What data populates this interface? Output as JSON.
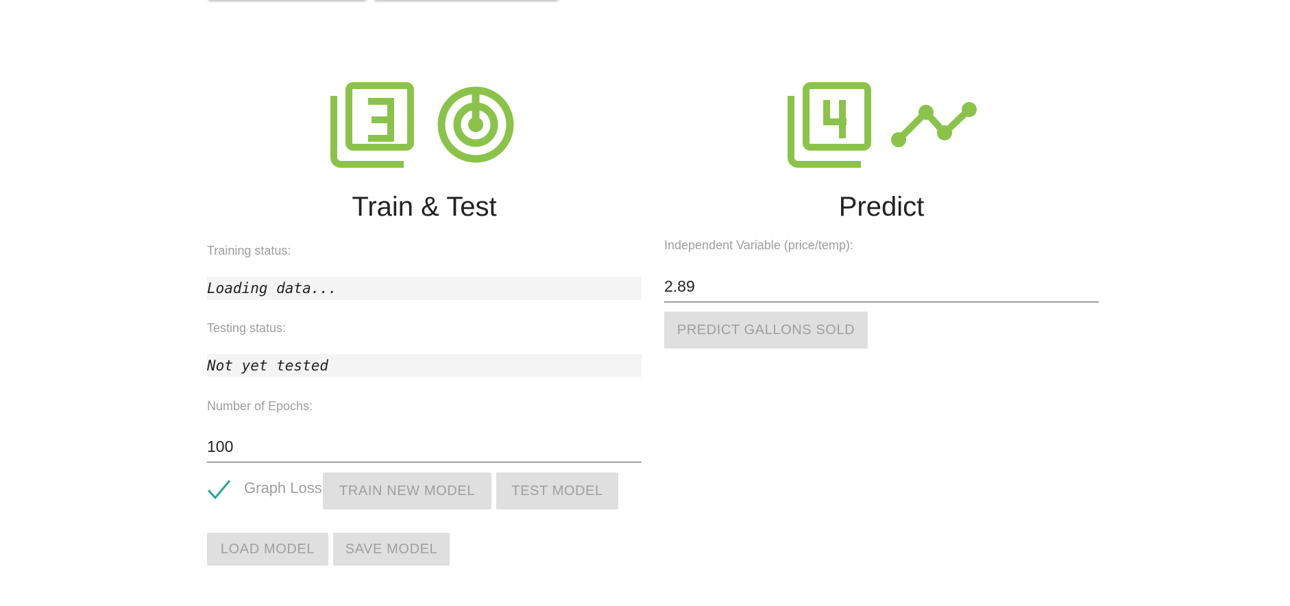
{
  "colors": {
    "accent": "#8bc34a",
    "checkbox": "#26a69a",
    "button_bg": "#dfdfdf",
    "button_text": "#9f9f9f",
    "label": "#9e9e9e",
    "status_bg": "#f4f4f4"
  },
  "train": {
    "icons": [
      "step-3-icon",
      "target-icon"
    ],
    "title": "Train & Test",
    "training_status_label": "Training status:",
    "training_status_value": "Loading data...",
    "testing_status_label": "Testing status:",
    "testing_status_value": "Not yet tested",
    "epochs_label": "Number of Epochs:",
    "epochs_value": "100",
    "graph_loss_label": "Graph Loss",
    "graph_loss_checked": true,
    "train_button": "TRAIN NEW MODEL",
    "test_button": "TEST MODEL",
    "load_button": "LOAD MODEL",
    "save_button": "SAVE MODEL"
  },
  "predict": {
    "icons": [
      "step-4-icon",
      "line-chart-icon"
    ],
    "title": "Predict",
    "variable_label": "Independent Variable (price/temp):",
    "variable_value": "2.89",
    "predict_button": "PREDICT GALLONS SOLD"
  }
}
